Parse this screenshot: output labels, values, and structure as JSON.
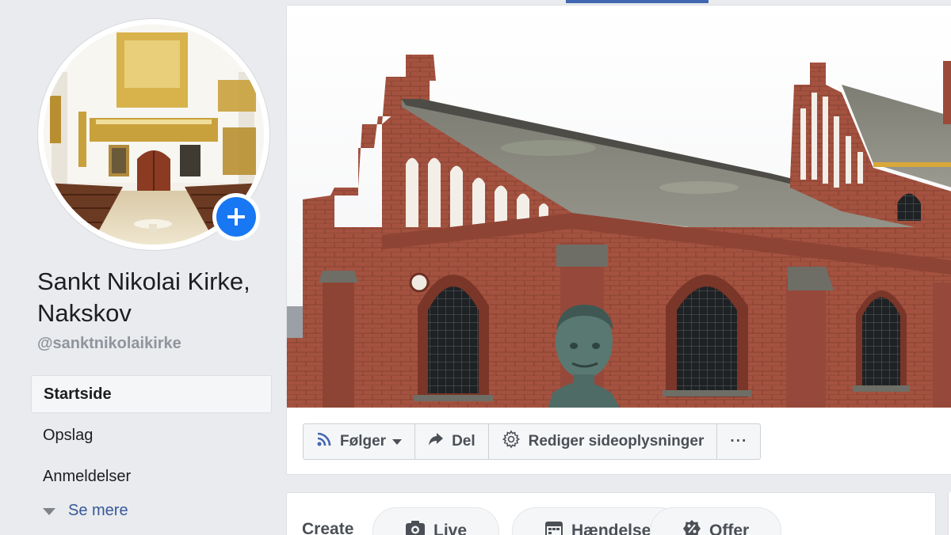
{
  "page": {
    "name": "Sankt Nikolai Kirke, Nakskov",
    "handle": "@sanktnikolaikirke"
  },
  "nav": {
    "items": [
      {
        "label": "Startside",
        "active": true
      },
      {
        "label": "Opslag",
        "active": false
      },
      {
        "label": "Anmeldelser",
        "active": false
      }
    ],
    "see_more": "Se mere"
  },
  "actions": {
    "follow_label": "Følger",
    "share_label": "Del",
    "edit_label": "Rediger sideoplysninger",
    "more_label": "···"
  },
  "create": {
    "label": "Create",
    "chips": [
      {
        "label": "Live",
        "icon": "camera-icon"
      },
      {
        "label": "Hændelse",
        "icon": "calendar-icon"
      },
      {
        "label": "Offer",
        "icon": "percent-tag-icon"
      }
    ]
  },
  "colors": {
    "accent": "#4267b2",
    "add_button": "#1877f2",
    "brick": "#9b4a3a",
    "roof": "#8a8a80"
  }
}
